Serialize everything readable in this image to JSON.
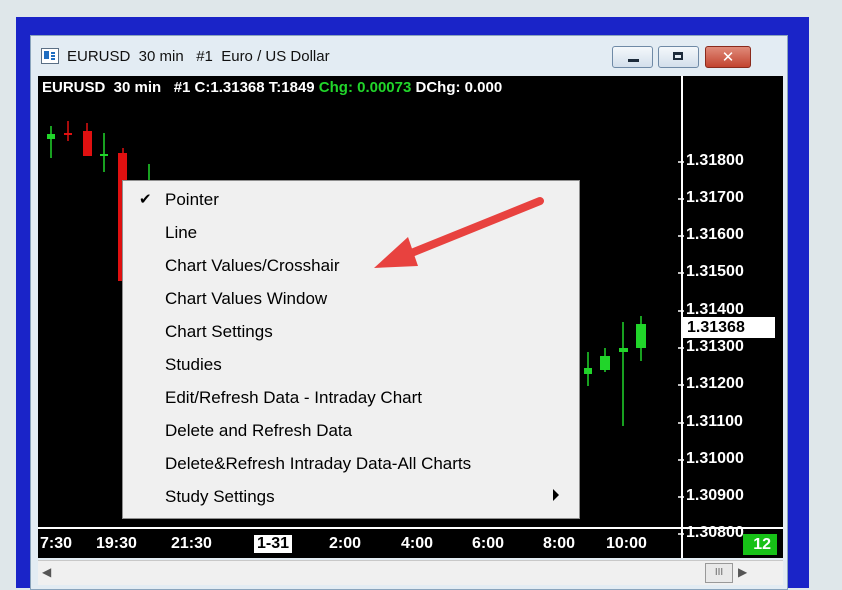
{
  "window": {
    "title": "EURUSD  30 min   #1  Euro / US Dollar",
    "minimize_icon": "minimize-icon",
    "maximize_icon": "maximize-icon",
    "close_icon": "close-icon",
    "close_glyph": "✕"
  },
  "chart": {
    "header_main": "EURUSD  30 min   #1 C:1.31368 T:1849 ",
    "header_chg": "Chg: 0.00073",
    "header_dchg": " DChg: 0.000",
    "price_labels": [
      "1.31800",
      "1.31700",
      "1.31600",
      "1.31500",
      "1.31400",
      "1.31300",
      "1.31200",
      "1.31100",
      "1.31000",
      "1.30900",
      "1.30800"
    ],
    "current_price": "1.31368",
    "time_labels": [
      "7:30",
      "19:30",
      "21:30",
      "1-31",
      "2:00",
      "4:00",
      "6:00",
      "8:00",
      "10:00"
    ],
    "highlighted_time": "1-31",
    "bar_count": "12",
    "colors": {
      "up": "#21d52a",
      "down": "#e01010",
      "background": "#000000"
    }
  },
  "context_menu": {
    "items": [
      {
        "label": "Pointer",
        "checked": true
      },
      {
        "label": "Line"
      },
      {
        "label": "Chart Values/Crosshair"
      },
      {
        "label": "Chart Values Window"
      },
      {
        "label": "Chart Settings"
      },
      {
        "label": "Studies"
      },
      {
        "label": "Edit/Refresh Data - Intraday Chart"
      },
      {
        "label": "Delete and Refresh Data"
      },
      {
        "label": "Delete&Refresh Intraday Data-All Charts"
      },
      {
        "label": "Study Settings",
        "submenu": true
      }
    ],
    "check_glyph": "✔"
  },
  "scrollbar": {
    "left_arrow": "◀",
    "right_arrow": "▶",
    "thumb_grip": "III"
  },
  "annotation": {
    "arrow_color": "#e8423f"
  }
}
